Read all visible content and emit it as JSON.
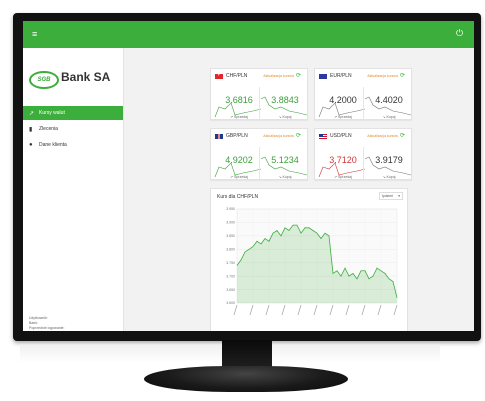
{
  "app": {
    "bank_name": "Bank SA",
    "logo_text": "SGB"
  },
  "nav": [
    {
      "icon": "trend-icon",
      "label": "Kursy walut",
      "active": true
    },
    {
      "icon": "document-icon",
      "label": "Zlecenia",
      "active": false
    },
    {
      "icon": "user-icon",
      "label": "Dane klienta",
      "active": false
    }
  ],
  "user": [
    "Użytkownik:",
    "Bank:",
    "Poprzednie logowanie:"
  ],
  "refresh_label": "Aktualizacja kursów",
  "pairs": [
    {
      "name": "CHF/PLN",
      "flag": "ch",
      "sell": "3.6816",
      "buy": "3.8843",
      "sell_color": "green",
      "buy_color": "green"
    },
    {
      "name": "EUR/PLN",
      "flag": "eu",
      "sell": "4.2000",
      "buy": "4.4020",
      "sell_color": "dark",
      "buy_color": "dark"
    },
    {
      "name": "GBP/PLN",
      "flag": "gb",
      "sell": "4.9202",
      "buy": "5.1234",
      "sell_color": "green",
      "buy_color": "green"
    },
    {
      "name": "USD/PLN",
      "flag": "us",
      "sell": "3.7120",
      "buy": "3.9179",
      "sell_color": "red",
      "buy_color": "dark"
    }
  ],
  "sell_label": "Sprzedaj",
  "buy_label": "Kupuj",
  "chart": {
    "title": "Kurs dla CHF/PLN",
    "select_value": "tydzień"
  },
  "chart_data": {
    "type": "area",
    "title": "Kurs dla CHF/PLN",
    "ylim": [
      3.6,
      3.95
    ],
    "yticks": [
      "3.950",
      "3.900",
      "3.850",
      "3.800",
      "3.750",
      "3.700",
      "3.650",
      "3.600"
    ],
    "values": [
      3.74,
      3.76,
      3.79,
      3.8,
      3.81,
      3.83,
      3.82,
      3.84,
      3.83,
      3.86,
      3.87,
      3.85,
      3.88,
      3.87,
      3.89,
      3.89,
      3.86,
      3.88,
      3.88,
      3.87,
      3.86,
      3.84,
      3.86,
      3.85,
      3.71,
      3.72,
      3.7,
      3.73,
      3.7,
      3.71,
      3.69,
      3.72,
      3.72,
      3.69,
      3.7,
      3.73,
      3.72,
      3.71,
      3.69,
      3.68,
      3.62
    ],
    "color": "#3cae3c"
  }
}
